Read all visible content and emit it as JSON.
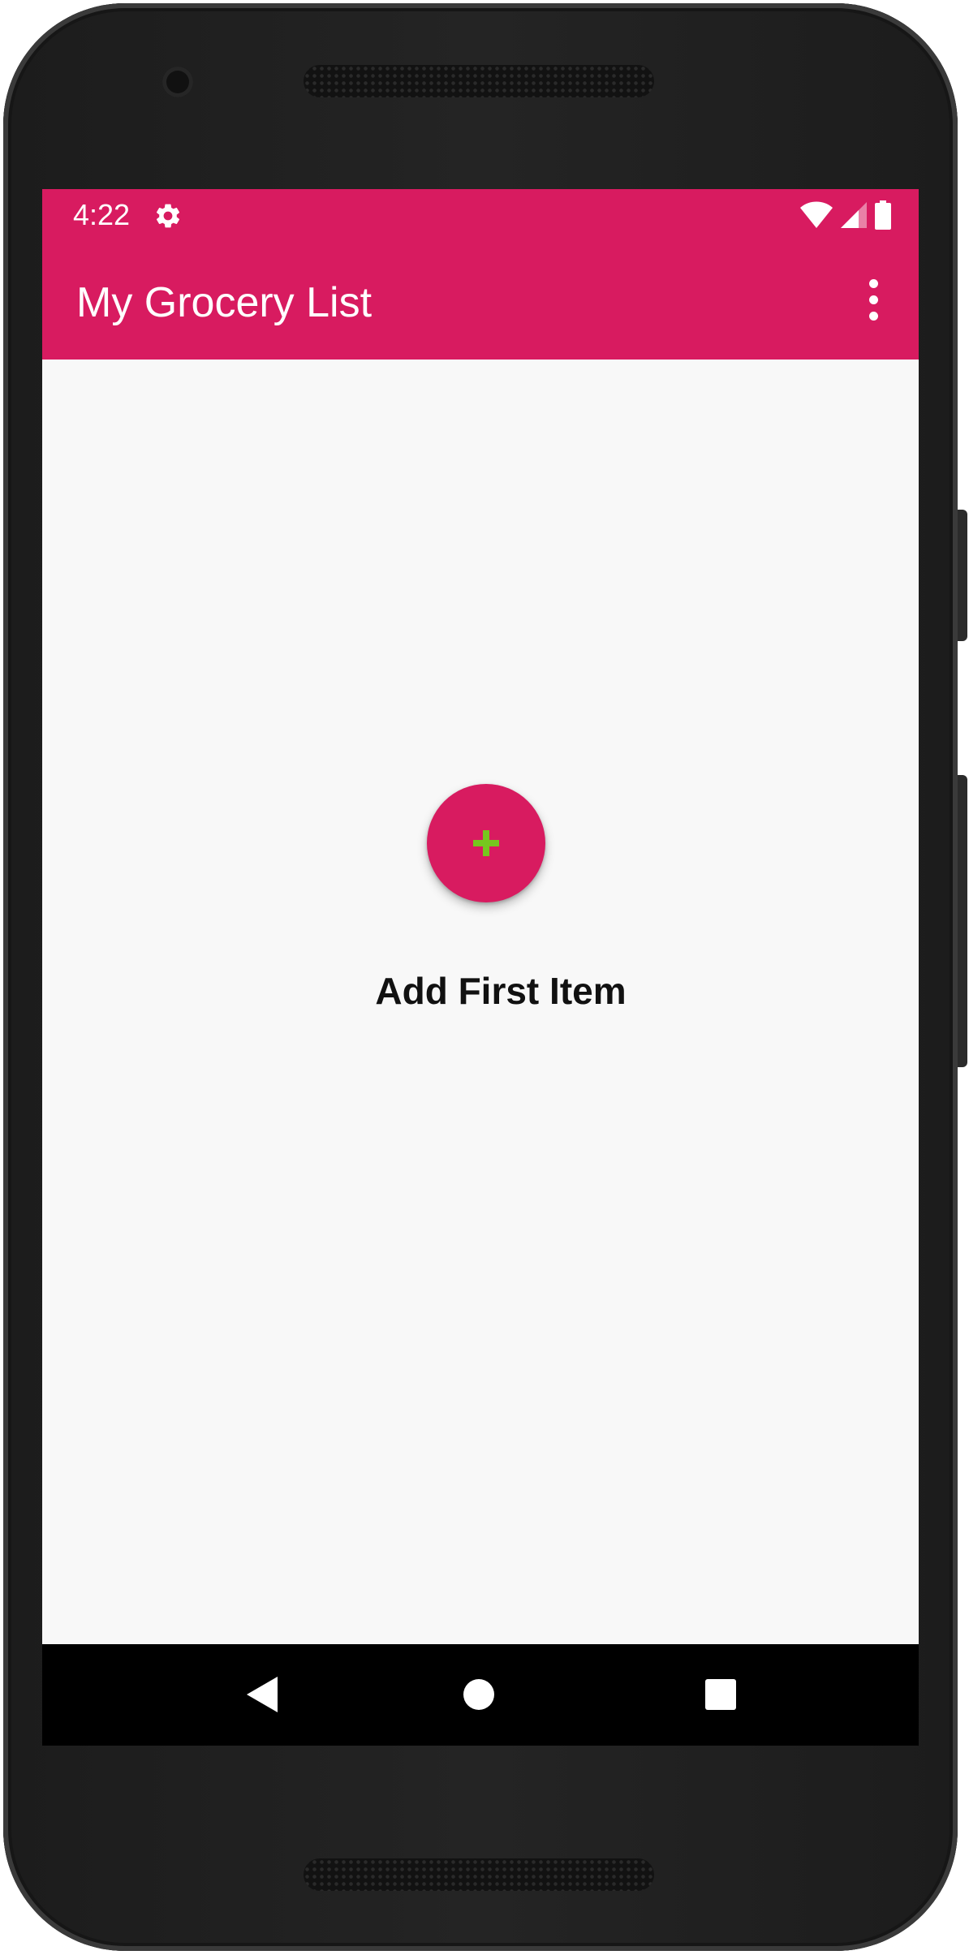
{
  "status_bar": {
    "time": "4:22",
    "icons": [
      "settings-gear-icon",
      "wifi-icon",
      "cell-signal-icon",
      "battery-icon"
    ]
  },
  "app_bar": {
    "title": "My Grocery List",
    "overflow_icon": "more-vert-icon"
  },
  "main": {
    "fab_icon": "plus-icon",
    "empty_label": "Add First Item"
  },
  "nav_bar": {
    "buttons": [
      "back-triangle-icon",
      "home-circle-icon",
      "recents-square-icon"
    ]
  },
  "colors": {
    "primary": "#d81b60",
    "accent": "#76c71e",
    "background": "#f8f8f8",
    "nav_bar": "#000000"
  }
}
